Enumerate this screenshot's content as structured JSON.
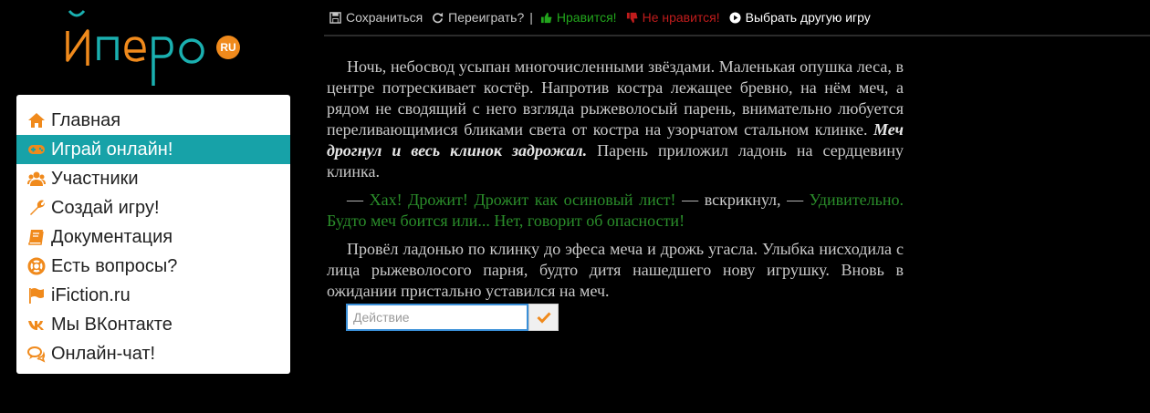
{
  "logo": {
    "text": "Йперо",
    "badge": "RU"
  },
  "sidebar": {
    "items": [
      {
        "label": "Главная",
        "icon": "home-icon",
        "active": false
      },
      {
        "label": "Играй онлайн!",
        "icon": "gamepad-icon",
        "active": true
      },
      {
        "label": "Участники",
        "icon": "users-icon",
        "active": false
      },
      {
        "label": "Создай игру!",
        "icon": "wrench-icon",
        "active": false
      },
      {
        "label": "Документация",
        "icon": "book-icon",
        "active": false
      },
      {
        "label": "Есть вопросы?",
        "icon": "lifebuoy-icon",
        "active": false
      },
      {
        "label": "iFiction.ru",
        "icon": "flag-icon",
        "active": false
      },
      {
        "label": "Мы ВКонтакте",
        "icon": "vk-icon",
        "active": false
      },
      {
        "label": "Онлайн-чат!",
        "icon": "chat-icon",
        "active": false
      }
    ]
  },
  "toolbar": {
    "save": "Сохраниться",
    "replay": "Переиграть?",
    "separator": "|",
    "like": "Нравится!",
    "dislike": "Не нравится!",
    "choose": "Выбрать другую игру"
  },
  "story": {
    "p1_text": "Ночь, небосвод усыпан многочисленными звёздами. Маленькая опушка леса, в центре потрескивает костёр. Напротив костра лежащее бревно, на нём меч, а рядом не сводящий с него взгляда рыжеволосый парень, внимательно любуется переливающимися бликами света от костра на узорчатом стальном клинке. ",
    "p1_emphasis": "Меч дрогнул и весь клинок задрожал.",
    "p1_tail": " Парень приложил ладонь на сердцевину клинка.",
    "p2_dash1": "— ",
    "p2_speech1": "Хах! Дрожит! Дрожит как осиновый лист!",
    "p2_mid": " — вскрикнул, — ",
    "p2_speech2": "Удивительно. Будто меч боится или... Нет, говорит об опасности!",
    "p3_text": "Провёл ладонью по клинку до эфеса меча и дрожь угасла. Улыбка нисходила с лица рыжеволосого парня, будто дитя нашедшего нову игрушку. Вновь в ожидании пристально уставился на меч."
  },
  "action": {
    "placeholder": "Действие",
    "value": ""
  },
  "colors": {
    "accent": "#17a2a8",
    "icon_orange": "#f08a1c",
    "like": "#22a51c",
    "dislike": "#c01c1c"
  }
}
